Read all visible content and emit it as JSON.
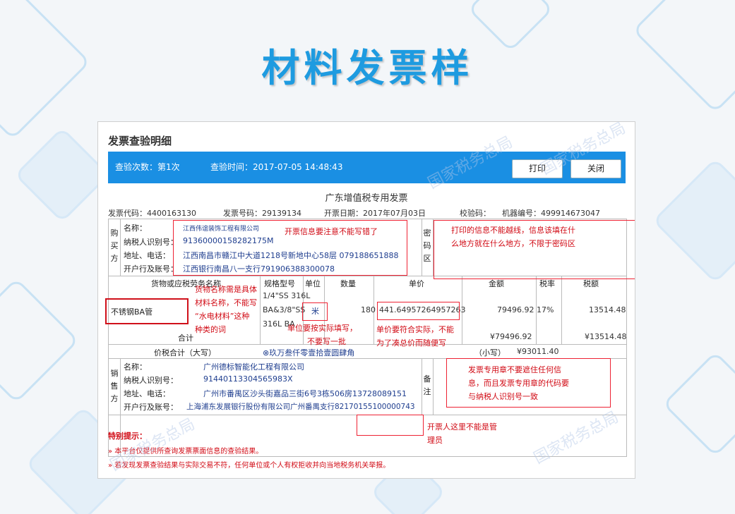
{
  "slide_title": "材料发票样",
  "panel": {
    "title": "发票查验明细",
    "query_count": "查验次数：第1次",
    "query_time": "查验时间：2017-07-05 14:48:43",
    "print_label": "打印",
    "close_label": "关闭"
  },
  "invoice": {
    "title": "广东增值税专用发票",
    "code_label": "发票代码：4400163130",
    "number_label": "发票号码：29139134",
    "date_label": "开票日期：2017年07月03日",
    "check_code_label": "校验码：",
    "machine_label": "机器编号：499914673047",
    "buyer": {
      "section_label": [
        "购",
        "买",
        "方"
      ],
      "name_label": "名称：",
      "name_value": "江西伟谊装饰工程有限公司",
      "tax_id_label": "纳税人识别号：",
      "tax_id_value": "91360000158282175M",
      "address_label": "地址、电话：",
      "address_value": "江西南昌市赣江中大道1218号新地中心58层 079188651888",
      "bank_label": "开户行及账号：",
      "bank_value": "江西银行南昌八一支行791906388300078"
    },
    "password_area_label": [
      "密",
      "码",
      "区"
    ],
    "columns": {
      "goods": "货物或应税劳务名称",
      "spec": "规格型号",
      "unit": "单位",
      "qty": "数量",
      "price": "单价",
      "amount": "金额",
      "rate": "税率",
      "tax": "税额"
    },
    "item": {
      "goods": "不锈钢BA管",
      "spec_lines": [
        "1/4\"SS 316L",
        "BA&3/8\"SS",
        "316L BA"
      ],
      "unit": "米",
      "qty": "180",
      "price": "441.64957264957263",
      "amount": "79496.92",
      "rate": "17%",
      "tax": "13514.48"
    },
    "total_label": "合计",
    "total_amount": "¥79496.92",
    "total_tax": "¥13514.48",
    "grand_label": "价税合计（大写）",
    "grand_words": "⊗玖万叁仟零壹拾壹圆肆角",
    "grand_small_label": "（小写）",
    "grand_small_value": "¥93011.40",
    "seller": {
      "section_label": [
        "销",
        "售",
        "方"
      ],
      "name_label": "名称：",
      "name_value": "广州德标智能化工程有限公司",
      "tax_id_label": "纳税人识别号：",
      "tax_id_value": "91440113304565983X",
      "address_label": "地址、电话：",
      "address_value": "广州市番禺区沙头街嘉品三街6号3栋506房13728089151",
      "bank_label": "开户行及账号：",
      "bank_value": "上海浦东发展银行股份有限公司广州番禺支行82170155100000743"
    },
    "remarks_label": [
      "备",
      "注"
    ]
  },
  "annotations": {
    "buyer_note": "开票信息要注意不能写错了",
    "password_note": [
      "打印的信息不能越线，信息该填在什",
      "么地方就在什么地方，不限于密码区"
    ],
    "goods_note": [
      "货物名称需是具体",
      "材料名称，不能写",
      "“水电材料”这种",
      "种类的词"
    ],
    "unit_note": [
      "单位要按实际填写，",
      "不要写一批"
    ],
    "price_note": [
      "单价要符合实际，不能",
      "为了凑总价而随便写"
    ],
    "seal_note": [
      "发票专用章不要遮住任何信",
      "息，而且发票专用章的代码要",
      "与纳税人识别号一致"
    ],
    "issuer_note": [
      "开票人这里不能是管",
      "理员"
    ]
  },
  "warnings": {
    "title": "特别提示：",
    "items": [
      "» 本平台仅提供所查询发票票面信息的查验结果。",
      "» 若发现发票查验结果与实际交易不符，任何单位或个人有权拒收并向当地税务机关举报。"
    ]
  },
  "watermark_text": "国家税务总局",
  "colors": {
    "accent": "#1a8fe3",
    "title": "#1e9be0",
    "annotation": "#d10a14",
    "value_text": "#1f3e8f"
  }
}
